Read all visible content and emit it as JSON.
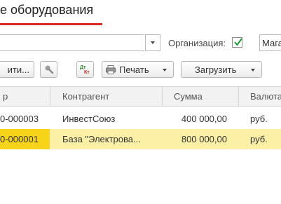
{
  "window": {
    "title": "е оборудования"
  },
  "filter": {
    "search_value": "",
    "organization_label": "Организация:",
    "organization_checked": true,
    "organization_value": "Мага"
  },
  "toolbar": {
    "choose_label": "ити...",
    "link_icon": "link-icon",
    "dtkt_icon": "dt-kt-icon",
    "print_label": "Печать",
    "load_label": "Загрузить"
  },
  "table": {
    "columns": [
      "р",
      "Контрагент",
      "Сумма",
      "Валюта"
    ],
    "rows": [
      {
        "number": "0-000003",
        "counterparty": "ИнвестСоюз",
        "amount": "400 000,00",
        "currency": "руб.",
        "selected": false
      },
      {
        "number": "0-000001",
        "counterparty": "База \"Электрова...",
        "amount": "800 000,00",
        "currency": "руб.",
        "selected": true
      }
    ]
  },
  "colors": {
    "accent_underline": "#d42a1f",
    "selected_row": "#fbf0a6",
    "selected_cell": "#f7d31a",
    "checkbox_green": "#1e9b3a"
  }
}
